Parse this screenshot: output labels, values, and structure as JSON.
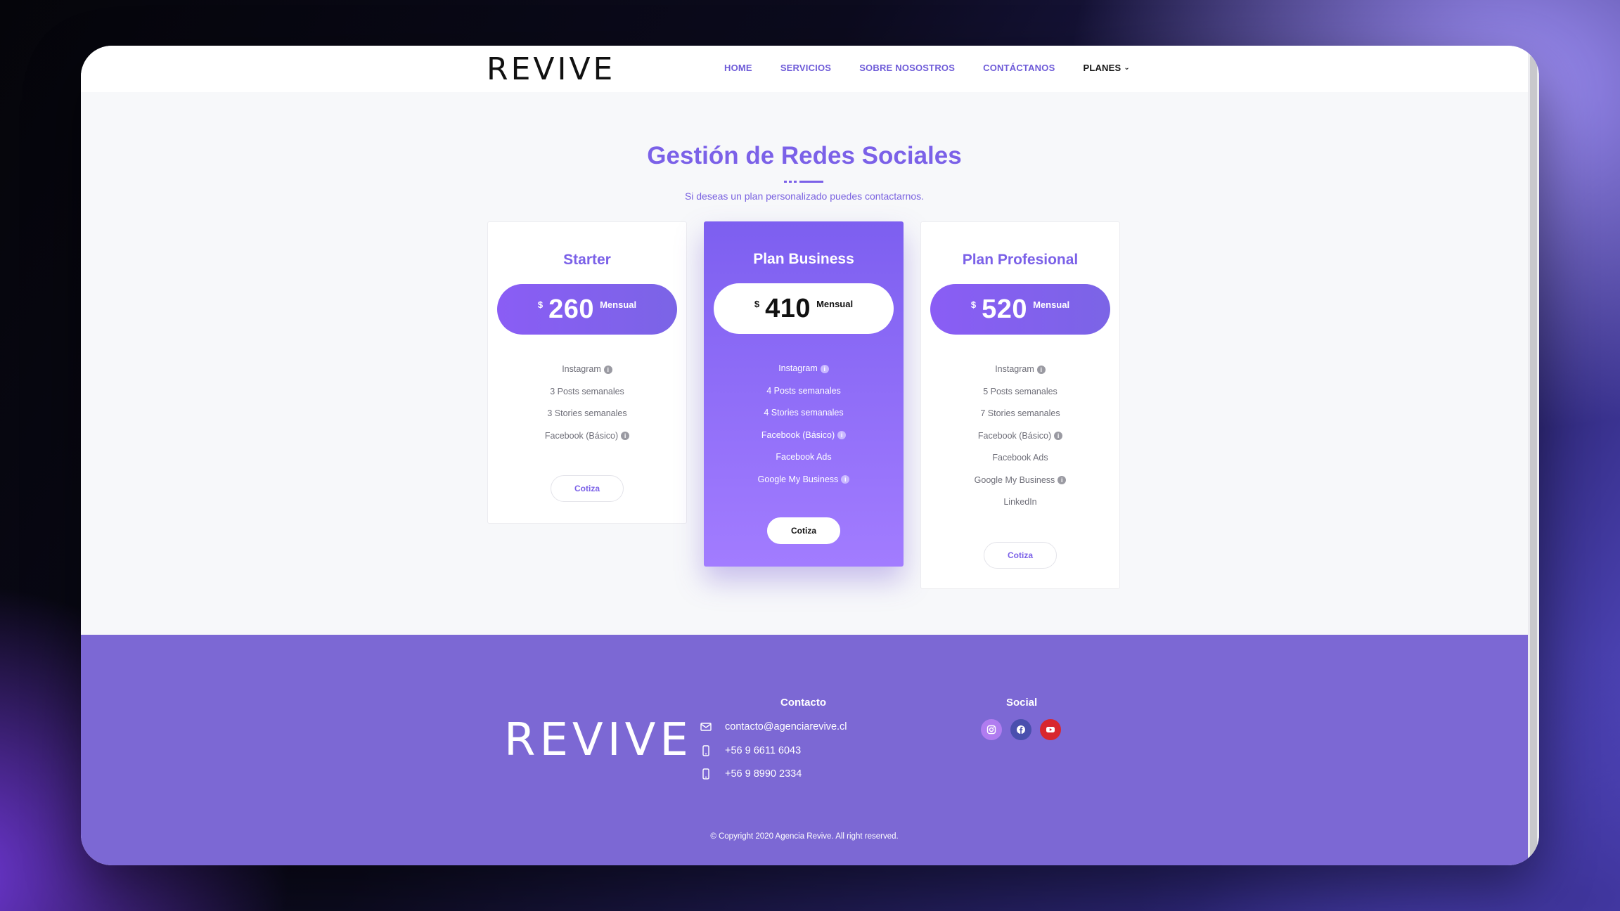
{
  "nav": {
    "logo": "REVIVE",
    "links": [
      "HOME",
      "SERVICIOS",
      "SOBRE NOSOSTROS",
      "CONTÁCTANOS"
    ],
    "planes_label": "PLANES"
  },
  "hero": {
    "title": "Gestión de Redes Sociales",
    "subtitle": "Si deseas un plan personalizado puedes contactarnos."
  },
  "plans": [
    {
      "name": "Starter",
      "currency": "$",
      "price": "260",
      "period": "Mensual",
      "features": [
        {
          "text": "Instagram",
          "info": true
        },
        {
          "text": "3 Posts semanales",
          "info": false
        },
        {
          "text": "3 Stories semanales",
          "info": false
        },
        {
          "text": "Facebook (Básico)",
          "info": true
        }
      ],
      "cta": "Cotiza"
    },
    {
      "name": "Plan Business",
      "currency": "$",
      "price": "410",
      "period": "Mensual",
      "features": [
        {
          "text": "Instagram",
          "info": true
        },
        {
          "text": "4 Posts semanales",
          "info": false
        },
        {
          "text": "4 Stories semanales",
          "info": false
        },
        {
          "text": "Facebook (Básico)",
          "info": true
        },
        {
          "text": "Facebook Ads",
          "info": false
        },
        {
          "text": "Google My Business",
          "info": true
        }
      ],
      "cta": "Cotiza"
    },
    {
      "name": "Plan Profesional",
      "currency": "$",
      "price": "520",
      "period": "Mensual",
      "features": [
        {
          "text": "Instagram",
          "info": true
        },
        {
          "text": "5 Posts semanales",
          "info": false
        },
        {
          "text": "7 Stories semanales",
          "info": false
        },
        {
          "text": "Facebook (Básico)",
          "info": true
        },
        {
          "text": "Facebook Ads",
          "info": false
        },
        {
          "text": "Google My Business",
          "info": true
        },
        {
          "text": "LinkedIn",
          "info": false
        }
      ],
      "cta": "Cotiza"
    }
  ],
  "footer": {
    "logo": "REVIVE",
    "contact_title": "Contacto",
    "email": "contacto@agenciarevive.cl",
    "phone1": "+56 9 6611 6043",
    "phone2": "+56 9 8990 2334",
    "social_title": "Social",
    "social_icons": [
      "instagram-icon",
      "facebook-icon",
      "youtube-icon"
    ],
    "copyright": "© Copyright 2020 Agencia Revive. All right reserved."
  },
  "colors": {
    "accent": "#7b61e8",
    "footer_bg": "#7c68d4",
    "instagram": "#b07cf0",
    "facebook": "#4a4fae",
    "youtube": "#d8272e"
  }
}
